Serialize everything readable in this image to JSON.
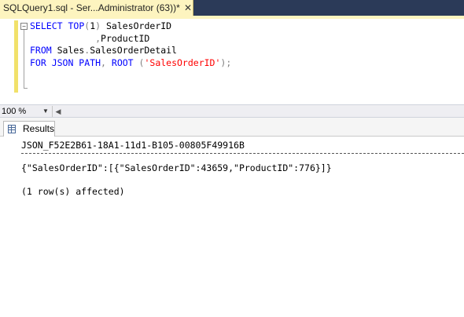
{
  "tab": {
    "title": "SQLQuery1.sql - Ser...Administrator (63))*",
    "close_glyph": "✕"
  },
  "editor": {
    "collapse_glyph": "−",
    "lines": [
      [
        {
          "t": "SELECT",
          "c": "kw"
        },
        {
          "t": " ",
          "c": ""
        },
        {
          "t": "TOP",
          "c": "kw"
        },
        {
          "t": "(",
          "c": "gr"
        },
        {
          "t": "1",
          "c": ""
        },
        {
          "t": ")",
          "c": "gr"
        },
        {
          "t": " SalesOrderID",
          "c": ""
        }
      ],
      [
        {
          "t": "            ",
          "c": ""
        },
        {
          "t": ",",
          "c": "gr"
        },
        {
          "t": "ProductID",
          "c": ""
        }
      ],
      [
        {
          "t": "FROM",
          "c": "kw"
        },
        {
          "t": " Sales",
          "c": ""
        },
        {
          "t": ".",
          "c": "gr"
        },
        {
          "t": "SalesOrderDetail",
          "c": ""
        }
      ],
      [
        {
          "t": "FOR JSON PATH",
          "c": "kw"
        },
        {
          "t": ",",
          "c": "gr"
        },
        {
          "t": " ",
          "c": ""
        },
        {
          "t": "ROOT",
          "c": "kw"
        },
        {
          "t": " ",
          "c": ""
        },
        {
          "t": "(",
          "c": "gr"
        },
        {
          "t": "'SalesOrderID'",
          "c": "str"
        },
        {
          "t": ");",
          "c": "gr"
        }
      ]
    ]
  },
  "zoom": {
    "value": "100 %",
    "arrow_glyph": "▼",
    "scroll_left_glyph": "◀"
  },
  "results": {
    "tab_label": "Results",
    "column_header": "JSON_F52E2B61-18A1-11d1-B105-00805F49916B",
    "row_value": "{\"SalesOrderID\":[{\"SalesOrderID\":43659,\"ProductID\":776}]}",
    "message": "(1 row(s) affected)"
  }
}
